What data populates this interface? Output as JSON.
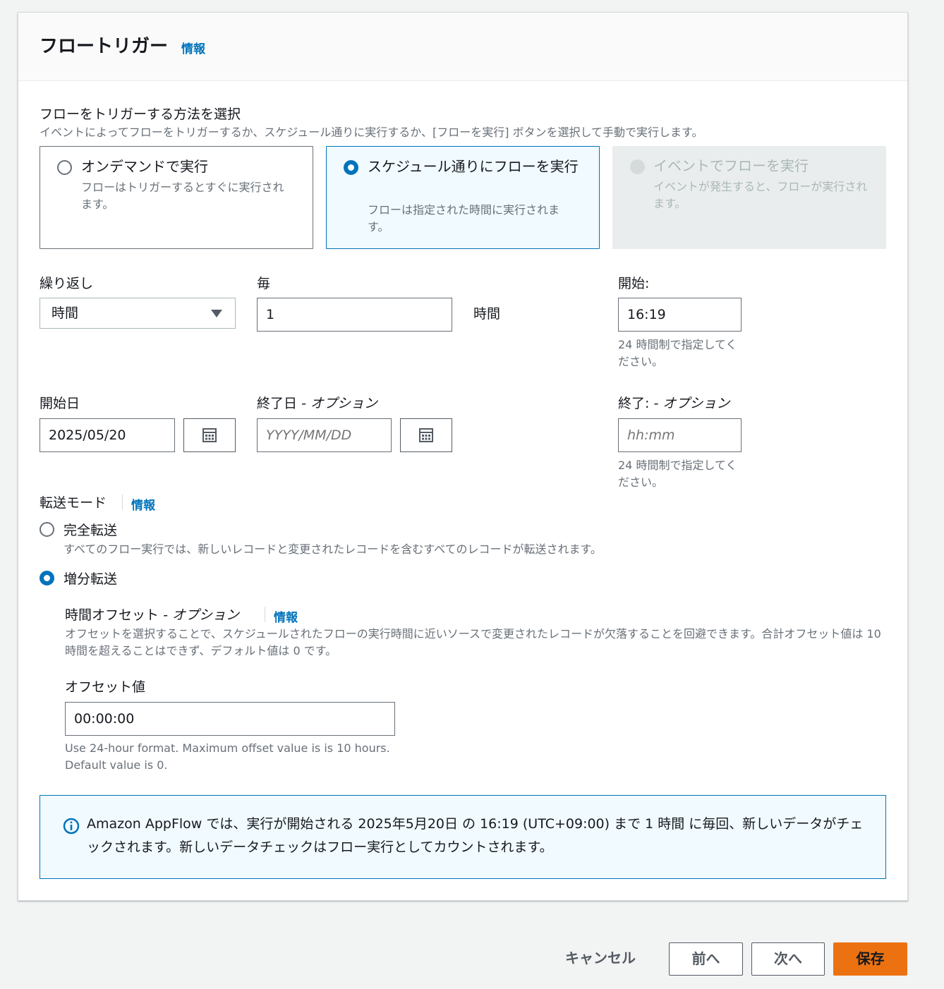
{
  "header": {
    "title": "フロートリガー",
    "info": "情報"
  },
  "trigger": {
    "heading": "フローをトリガーする方法を選択",
    "description": "イベントによってフローをトリガーするか、スケジュール通りに実行するか、[フローを実行] ボタンを選択して手動で実行します。",
    "options": [
      {
        "title": "オンデマンドで実行",
        "desc": "フローはトリガーするとすぐに実行されます。",
        "state": "unselected"
      },
      {
        "title": "スケジュール通りにフローを実行",
        "desc": "フローは指定された時間に実行されます。",
        "state": "selected"
      },
      {
        "title": "イベントでフローを実行",
        "desc": "イベントが発生すると、フローが実行されます。",
        "state": "disabled"
      }
    ]
  },
  "schedule": {
    "repeat_label": "繰り返し",
    "repeat_value": "時間",
    "every_label": "毎",
    "every_value": "1",
    "every_unit": "時間",
    "start_label": "開始:",
    "start_value": "16:19",
    "start_hint": "24 時間制で指定してください。",
    "start_date_label": "開始日",
    "start_date_value": "2025/05/20",
    "end_date_label": "終了日",
    "end_date_optional": "- オプション",
    "end_date_placeholder": "YYYY/MM/DD",
    "end_label": "終了:",
    "end_optional": "- オプション",
    "end_placeholder": "hh:mm",
    "end_hint": "24 時間制で指定してください。"
  },
  "transfer": {
    "label": "転送モード",
    "info": "情報",
    "full": {
      "title": "完全転送",
      "desc": "すべてのフロー実行では、新しいレコードと変更されたレコードを含むすべてのレコードが転送されます。",
      "checked": false
    },
    "incremental": {
      "title": "増分転送",
      "checked": true
    },
    "offset": {
      "label": "時間オフセット",
      "optional": "- オプション",
      "info": "情報",
      "desc": "オフセットを選択することで、スケジュールされたフローの実行時間に近いソースで変更されたレコードが欠落することを回避できます。合計オフセット値は 10 時間を超えることはできず、デフォルト値は 0 です。",
      "value_label": "オフセット値",
      "value": "00:00:00",
      "hint": "Use 24-hour format. Maximum offset value is is 10 hours. Default value is 0."
    }
  },
  "alert": {
    "text": "Amazon AppFlow では、実行が開始される 2025年5月20日 の 16:19 (UTC+09:00) まで 1 時間 に毎回、新しいデータがチェックされます。新しいデータチェックはフロー実行としてカウントされます。"
  },
  "footer": {
    "cancel": "キャンセル",
    "prev": "前へ",
    "next": "次へ",
    "save": "保存"
  },
  "colors": {
    "accent": "#0073bb",
    "primary_button": "#ec7211",
    "info_bg": "#f1faff"
  }
}
